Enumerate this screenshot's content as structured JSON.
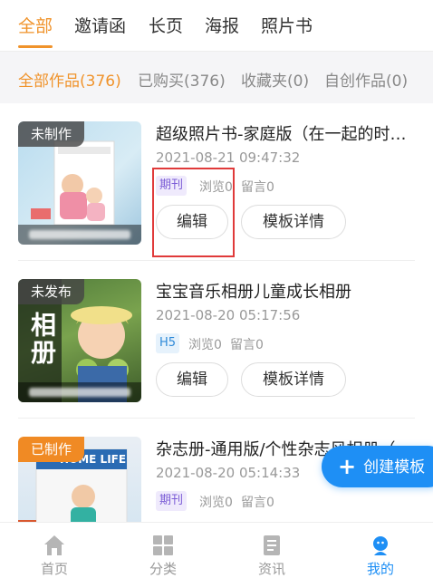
{
  "top_tabs": [
    {
      "label": "全部",
      "active": true
    },
    {
      "label": "邀请函",
      "active": false
    },
    {
      "label": "长页",
      "active": false
    },
    {
      "label": "海报",
      "active": false
    },
    {
      "label": "照片书",
      "active": false
    }
  ],
  "filters": [
    {
      "label": "全部作品(376)",
      "active": true
    },
    {
      "label": "已购买(376)",
      "active": false
    },
    {
      "label": "收藏夹(0)",
      "active": false
    },
    {
      "label": "自创作品(0)",
      "active": false
    }
  ],
  "works": [
    {
      "status": "未制作",
      "title": "超级照片书-家庭版（在一起的时…",
      "date": "2021-08-21 09:47:32",
      "type": "期刊",
      "views": "浏览0",
      "comments": "留言0",
      "edit_label": "编辑",
      "detail_label": "模板详情"
    },
    {
      "status": "未发布",
      "title": "宝宝音乐相册儿童成长相册",
      "date": "2021-08-20 05:17:56",
      "type": "H5",
      "views": "浏览0",
      "comments": "留言0",
      "edit_label": "编辑",
      "detail_label": "模板详情",
      "cover_text": "相册"
    },
    {
      "status": "已制作",
      "title": "杂志册-通用版/个性杂志风相册（",
      "date": "2021-08-20 05:14:33",
      "type": "期刊",
      "views": "浏览0",
      "comments": "留言0",
      "cover_text": "HOME LIFE"
    }
  ],
  "fab": {
    "label": "创建模板",
    "icon": "plus-icon"
  },
  "bottom_nav": [
    {
      "label": "首页",
      "icon": "home-icon",
      "active": false
    },
    {
      "label": "分类",
      "icon": "grid-icon",
      "active": false
    },
    {
      "label": "资讯",
      "icon": "news-icon",
      "active": false
    },
    {
      "label": "我的",
      "icon": "user-icon",
      "active": true
    }
  ],
  "colors": {
    "accent": "#f0932b",
    "primary": "#1e8ff5",
    "highlight": "#e03a3a"
  }
}
